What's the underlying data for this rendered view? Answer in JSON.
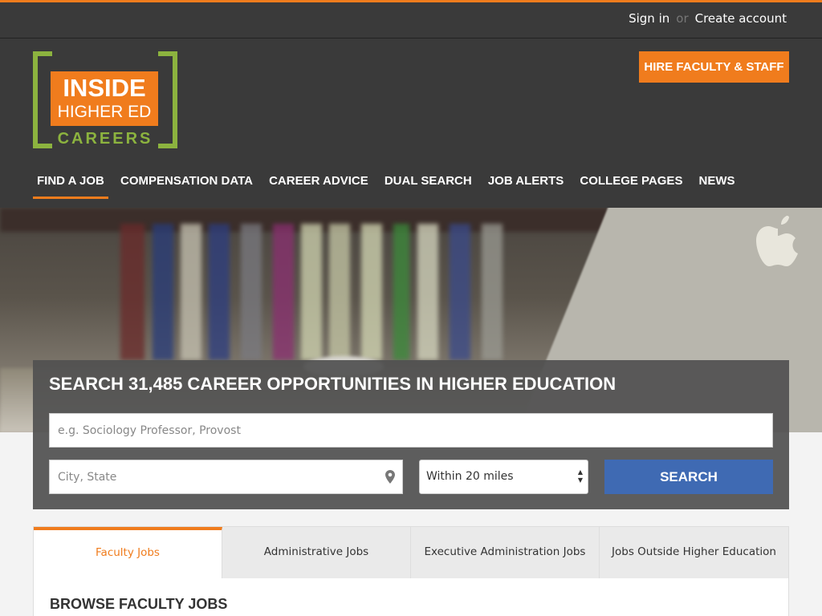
{
  "header": {
    "sign_in": "Sign in",
    "or": "or",
    "create_account": "Create account",
    "hire_button": "HIRE FACULTY & STAFF"
  },
  "logo": {
    "line1": "INSIDE",
    "line2": "HIGHER ED",
    "line3": "CAREERS"
  },
  "nav": {
    "items": [
      {
        "label": "FIND A JOB"
      },
      {
        "label": "COMPENSATION DATA"
      },
      {
        "label": "CAREER ADVICE"
      },
      {
        "label": "DUAL SEARCH"
      },
      {
        "label": "JOB ALERTS"
      },
      {
        "label": "COLLEGE PAGES"
      },
      {
        "label": "NEWS"
      }
    ]
  },
  "search": {
    "title": "SEARCH 31,485 CAREER OPPORTUNITIES IN HIGHER EDUCATION",
    "keyword_placeholder": "e.g. Sociology Professor, Provost",
    "keyword_value": "",
    "location_placeholder": "City, State",
    "location_value": "",
    "radius_selected": "Within 20 miles",
    "button": "SEARCH"
  },
  "tabs": [
    {
      "label": "Faculty Jobs"
    },
    {
      "label": "Administrative Jobs"
    },
    {
      "label": "Executive Administration Jobs"
    },
    {
      "label": "Jobs Outside Higher Education"
    }
  ],
  "browse": {
    "title": "BROWSE FACULTY JOBS"
  },
  "colors": {
    "accent": "#f07c1d",
    "logo_green": "#8cb33f",
    "search_button": "#3f6ab3",
    "header_bg": "#3a3a3a"
  },
  "icons": {
    "location": "map-pin-icon",
    "select_arrows": "select-arrows-icon",
    "hero_logo": "apple-logo-icon"
  }
}
